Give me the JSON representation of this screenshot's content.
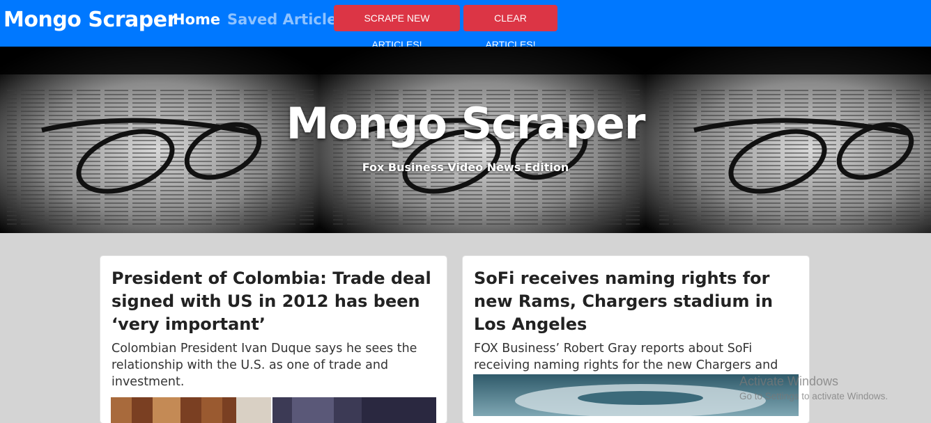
{
  "navbar": {
    "brand": "Mongo Scraper",
    "links": [
      {
        "label": "Home"
      },
      {
        "label": "Saved Articles"
      }
    ],
    "buttons": {
      "scrape": "SCRAPE NEW ARTICLES!",
      "clear": "CLEAR ARTICLES!"
    },
    "colors": {
      "bar": "#0078ff",
      "button": "#dc3545"
    }
  },
  "hero": {
    "title": "Mongo Scraper",
    "subtitle": "Fox Business Video News Edition"
  },
  "articles": [
    {
      "title": "President of Colombia: Trade deal signed with US in 2012 has been ‘very important’",
      "description": "Colombian President Ivan Duque says he sees the relationship with the U.S. as one of trade and investment."
    },
    {
      "title": "SoFi receives naming rights for new Rams, Chargers stadium in Los Angeles",
      "description": "FOX Business’ Robert Gray reports about SoFi receiving naming rights for the new Chargers and Rams stadium in Los Angeles."
    }
  ],
  "watermark": {
    "title": "Activate Windows",
    "subtitle": "Go to Settings to activate Windows."
  }
}
